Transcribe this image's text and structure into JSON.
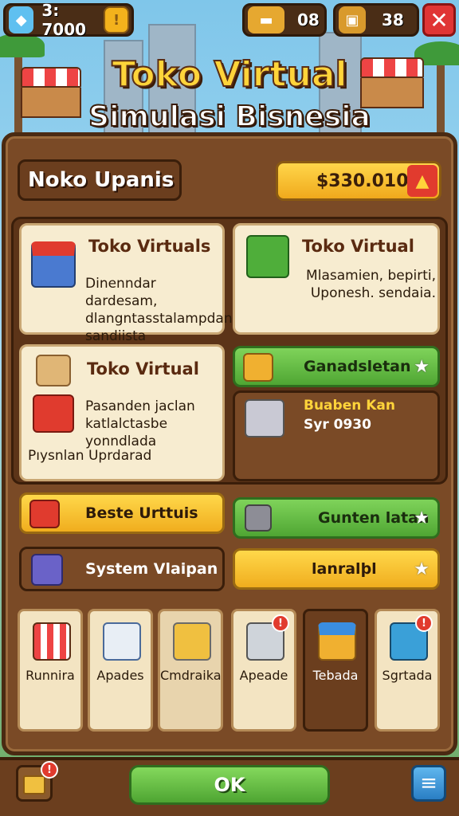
{
  "header": {
    "gems": "3: 7000",
    "resource_a": "08",
    "resource_b": "38",
    "close_symbol": "✕",
    "coin_symbol": "!",
    "title_line1": "Toko Virtual",
    "title_line2": "Simulasi Bisnesia"
  },
  "store": {
    "player_name": "Noko Upanis",
    "money": "$330.010"
  },
  "cards": [
    {
      "title": "Toko Virtuals",
      "desc": "Dinenndar dardesam, dlangntasstalampdan sandiista"
    },
    {
      "title": "Toko Virtual",
      "desc": "Mlasamien, bepirti, Uponesh. sendaia."
    },
    {
      "title": "Toko Virtual",
      "desc": "Pasanden jaclan katlalctasbe yonndlada",
      "footer": "Pıysnlan Uprdarad"
    }
  ],
  "actions": {
    "green_top": "Ganadsletan",
    "info_title": "Buaben Kan",
    "info_value": "Syr 0930",
    "orange_btn": "Beste Urttuis",
    "green_mid": "Gunten latan",
    "brown_btn": "System Vlaipan",
    "yellow_btn": "lanralþl",
    "star_symbol": "★"
  },
  "tiles": [
    {
      "label": "Runnira",
      "badge": ""
    },
    {
      "label": "Apades",
      "badge": ""
    },
    {
      "label": "Cmdraika",
      "badge": ""
    },
    {
      "label": "Apeade",
      "badge": "!"
    },
    {
      "label": "Tebada",
      "badge": ""
    },
    {
      "label": "Sgrtada",
      "badge": "!"
    }
  ],
  "footer": {
    "ok_label": "OK",
    "inventory_badge": "!",
    "menu_symbol": "≡"
  }
}
